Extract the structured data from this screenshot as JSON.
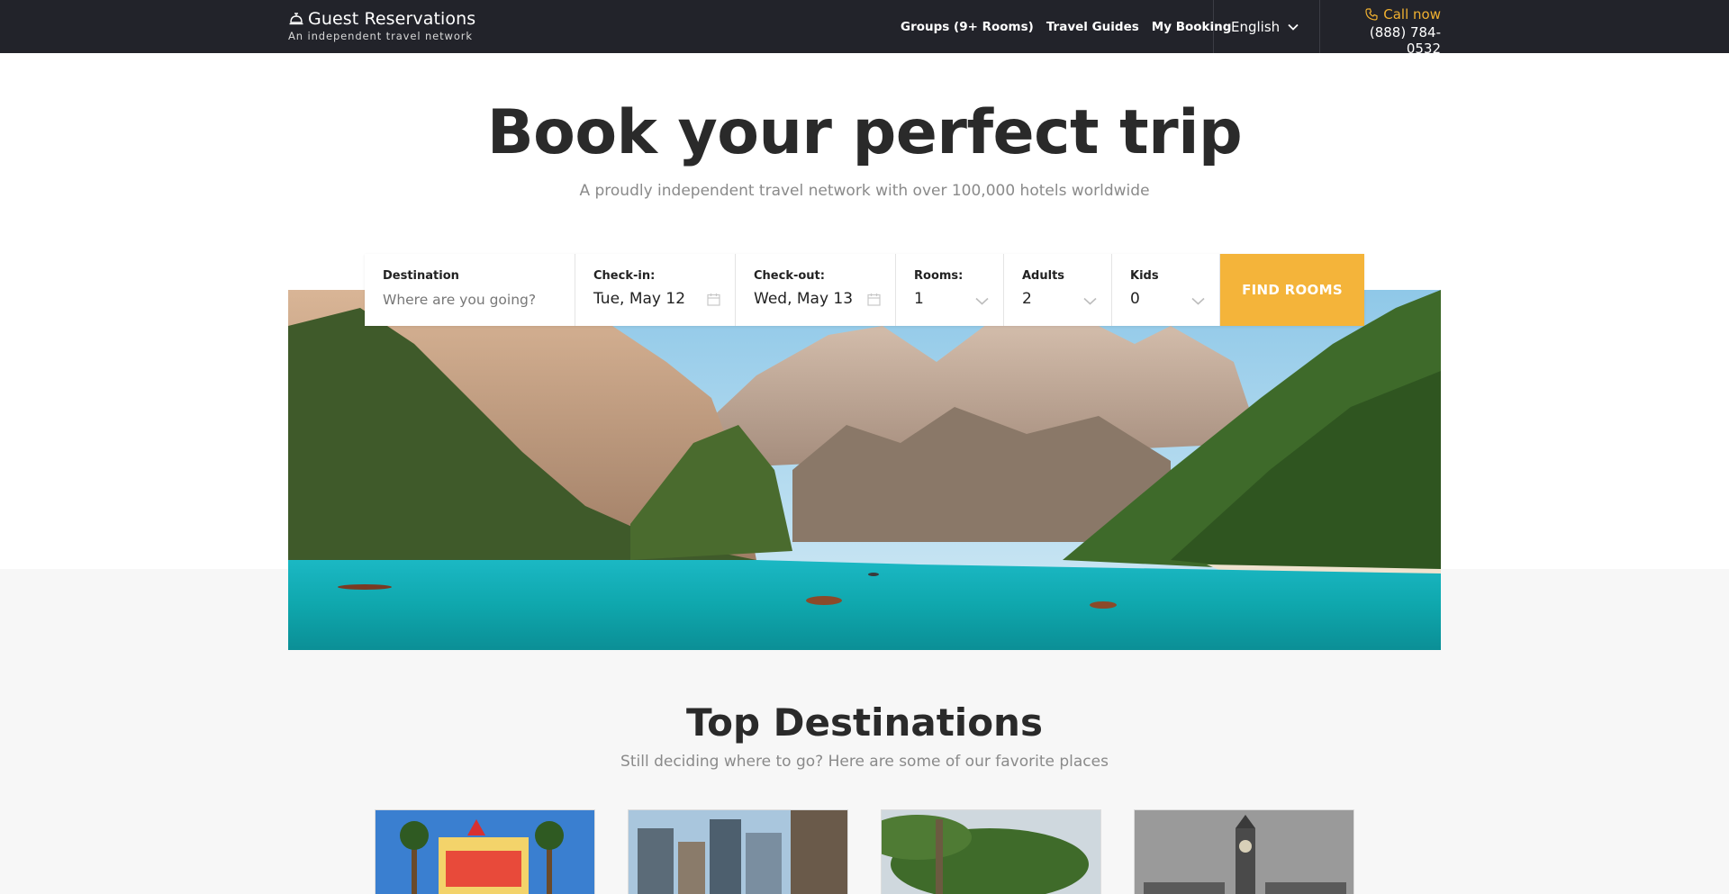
{
  "header": {
    "brand_name": "Guest Reservations",
    "brand_tagline": "An independent travel network",
    "nav": [
      {
        "label": "Groups (9+ Rooms)"
      },
      {
        "label": "Travel Guides"
      },
      {
        "label": "My Booking"
      }
    ],
    "language": "English",
    "call_label": "Call now",
    "phone": "(888) 784-0532"
  },
  "hero": {
    "title": "Book your perfect trip",
    "subtitle": "A proudly independent travel network with over 100,000 hotels worldwide"
  },
  "search": {
    "destination_label": "Destination",
    "destination_placeholder": "Where are you going?",
    "checkin_label": "Check-in:",
    "checkin_value": "Tue, May 12",
    "checkout_label": "Check-out:",
    "checkout_value": "Wed, May 13",
    "rooms_label": "Rooms:",
    "rooms_value": "1",
    "adults_label": "Adults",
    "adults_value": "2",
    "kids_label": "Kids",
    "kids_value": "0",
    "button_label": "FIND ROOMS"
  },
  "top_destinations": {
    "title": "Top Destinations",
    "subtitle": "Still deciding where to go? Here are some of our favorite places"
  },
  "colors": {
    "nav_bg": "#22232a",
    "accent": "#f4b43a",
    "call_color": "#f0b030"
  },
  "icons": [
    "bell-icon",
    "chevron-down-icon",
    "phone-icon",
    "calendar-icon"
  ]
}
